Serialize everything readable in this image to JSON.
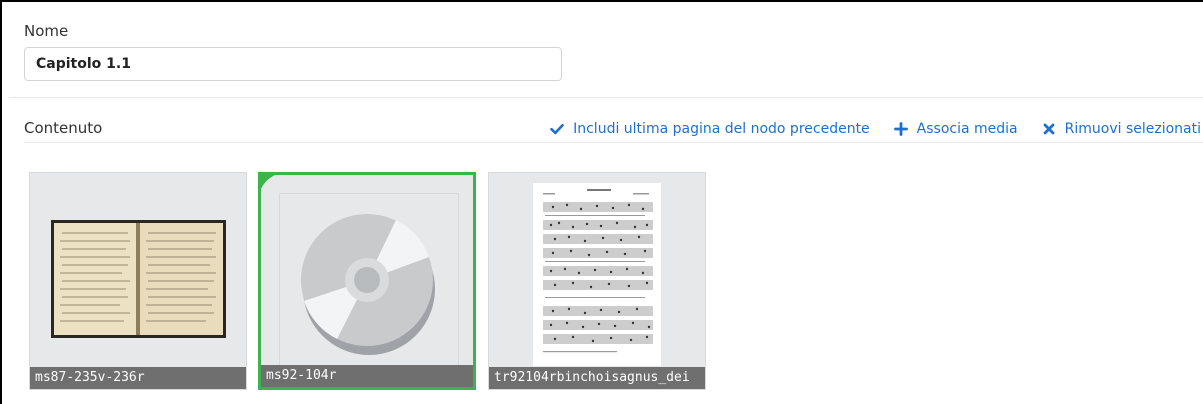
{
  "form": {
    "name_label": "Nome",
    "name_value": "Capitolo 1.1",
    "content_label": "Contenuto"
  },
  "actions": [
    {
      "label": "Includi ultima pagina del nodo precedente",
      "icon": "check-icon"
    },
    {
      "label": "Associa media",
      "icon": "plus-icon"
    },
    {
      "label": "Rimuovi selezionati",
      "icon": "x-icon"
    }
  ],
  "media": [
    {
      "name": "ms87-235v-236r",
      "thumbnail": "manuscript-image",
      "selected": false
    },
    {
      "name": "ms92-104r",
      "thumbnail": "disc-icon",
      "selected": true
    },
    {
      "name": "tr92104rbinchoisagnus_dei",
      "thumbnail": "sheet-music-image",
      "selected": false
    }
  ],
  "colors": {
    "accent": "#1f6fd1",
    "selected": "#3bb54a",
    "caption_bg": "#6f6f6f",
    "tile_bg": "#e6e8ea"
  }
}
